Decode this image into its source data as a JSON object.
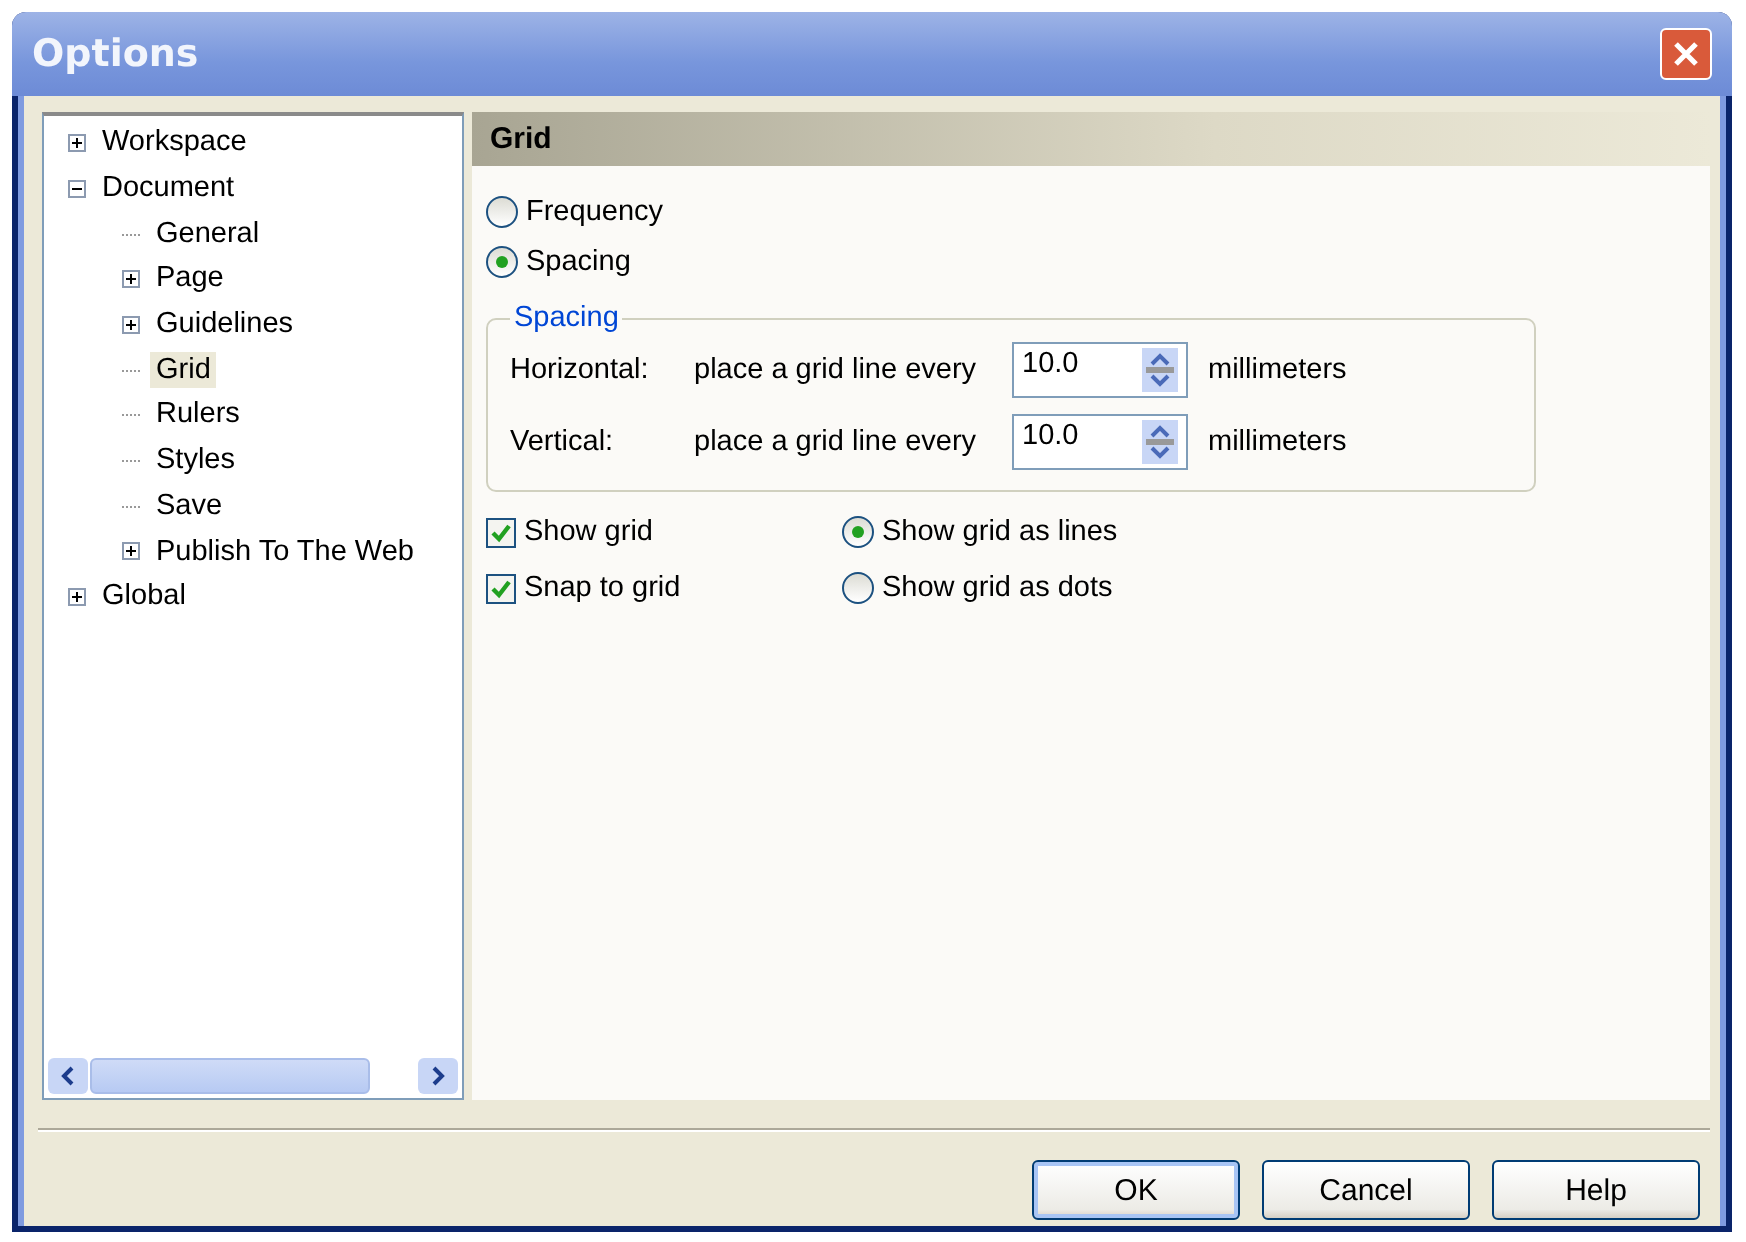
{
  "window": {
    "title": "Options"
  },
  "tree": [
    {
      "label": "Workspace",
      "expanded": false,
      "selected": false
    },
    {
      "label": "Document",
      "expanded": true,
      "selected": false,
      "children": [
        {
          "label": "General",
          "selected": false
        },
        {
          "label": "Page",
          "expanded": false,
          "selected": false
        },
        {
          "label": "Guidelines",
          "expanded": false,
          "selected": false
        },
        {
          "label": "Grid",
          "selected": true
        },
        {
          "label": "Rulers",
          "selected": false
        },
        {
          "label": "Styles",
          "selected": false
        },
        {
          "label": "Save",
          "selected": false
        },
        {
          "label": "Publish To The Web",
          "expanded": false,
          "selected": false
        }
      ]
    },
    {
      "label": "Global",
      "expanded": false,
      "selected": false
    }
  ],
  "panel": {
    "title": "Grid",
    "modes": [
      {
        "label": "Frequency",
        "selected": false
      },
      {
        "label": "Spacing",
        "selected": true
      }
    ],
    "group": {
      "title": "Spacing",
      "rows": [
        {
          "label": "Horizontal:",
          "text": "place a grid line every",
          "value": "10.0",
          "unit": "millimeters"
        },
        {
          "label": "Vertical:",
          "text": "place a grid line every",
          "value": "10.0",
          "unit": "millimeters"
        }
      ]
    },
    "checks": [
      {
        "label": "Show grid",
        "checked": true
      },
      {
        "label": "Snap to grid",
        "checked": true
      }
    ],
    "styles": [
      {
        "label": "Show grid as lines",
        "selected": true
      },
      {
        "label": "Show grid as dots",
        "selected": false
      }
    ]
  },
  "buttons": [
    "OK",
    "Cancel",
    "Help"
  ]
}
